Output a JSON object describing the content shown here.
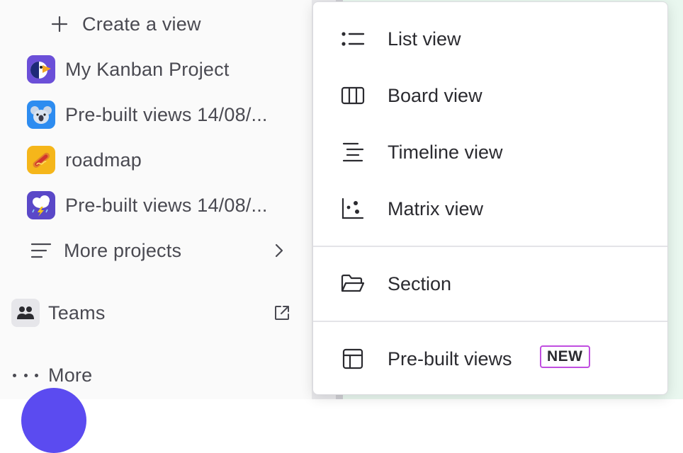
{
  "sidebar": {
    "create_view_label": "Create a view",
    "projects": [
      {
        "label": "My Kanban Project",
        "icon": "toucan-icon",
        "color": "#6b4fd8"
      },
      {
        "label": "Pre-built views 14/08/...",
        "icon": "koala-icon",
        "color": "#2d8cf0"
      },
      {
        "label": "roadmap",
        "icon": "hotdog-icon",
        "color": "#f5b61a"
      },
      {
        "label": "Pre-built views 14/08/...",
        "icon": "storm-cloud-icon",
        "color": "#5a48c8"
      }
    ],
    "more_projects_label": "More projects",
    "teams_label": "Teams",
    "more_label": "More"
  },
  "menu": {
    "items": [
      {
        "label": "List view",
        "icon": "list-icon"
      },
      {
        "label": "Board view",
        "icon": "board-icon"
      },
      {
        "label": "Timeline view",
        "icon": "timeline-icon"
      },
      {
        "label": "Matrix view",
        "icon": "matrix-icon"
      },
      {
        "label": "Section",
        "icon": "folder-open-icon"
      },
      {
        "label": "Pre-built views",
        "icon": "layout-icon",
        "badge": "NEW"
      }
    ]
  },
  "colors": {
    "accent": "#5b4bf0",
    "badge_border": "#c04ee0",
    "background_right": "#e9f7ef"
  }
}
